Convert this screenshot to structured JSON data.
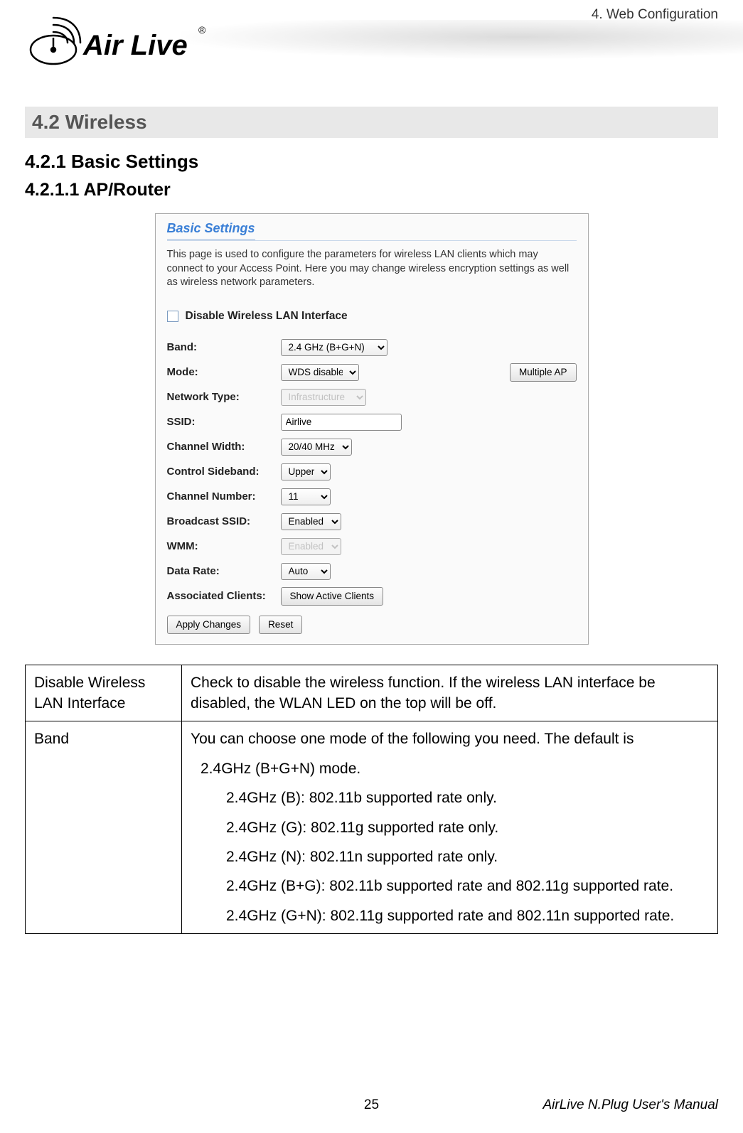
{
  "header": {
    "breadcrumb": "4.  Web  Configuration",
    "logo_brand": "Air Live",
    "logo_reg": "®"
  },
  "section": {
    "title": "4.2   Wireless",
    "sub1": "4.2.1 Basic Settings",
    "sub2": "4.2.1.1 AP/Router"
  },
  "screenshot": {
    "panel_title": "Basic Settings",
    "intro": "This page is used to configure the parameters for wireless LAN clients which may connect to your Access Point. Here you may change wireless encryption settings as well as wireless network parameters.",
    "disable_checkbox_label": "Disable Wireless LAN Interface",
    "rows": {
      "band": {
        "label": "Band:",
        "value": "2.4 GHz (B+G+N)"
      },
      "mode": {
        "label": "Mode:",
        "value": "WDS disable",
        "button": "Multiple AP"
      },
      "network_type": {
        "label": "Network Type:",
        "value": "Infrastructure"
      },
      "ssid": {
        "label": "SSID:",
        "value": "Airlive"
      },
      "channel_width": {
        "label": "Channel Width:",
        "value": "20/40 MHz"
      },
      "control_sideband": {
        "label": "Control Sideband:",
        "value": "Upper"
      },
      "channel_number": {
        "label": "Channel Number:",
        "value": "11"
      },
      "broadcast_ssid": {
        "label": "Broadcast SSID:",
        "value": "Enabled"
      },
      "wmm": {
        "label": "WMM:",
        "value": "Enabled"
      },
      "data_rate": {
        "label": "Data Rate:",
        "value": "Auto"
      },
      "assoc_clients": {
        "label": "Associated Clients:",
        "button": "Show Active Clients"
      }
    },
    "buttons": {
      "apply": "Apply Changes",
      "reset": "Reset"
    }
  },
  "desc_table": {
    "row1": {
      "label": "Disable Wireless LAN Interface",
      "desc": "Check to disable the wireless function. If the wireless LAN interface be disabled, the WLAN LED on the top will be off."
    },
    "row2": {
      "label": "Band",
      "desc_intro": "You can choose one mode of the following you need. The default is",
      "mode_default": "2.4GHz (B+G+N) mode.",
      "item_b": "2.4GHz (B): 802.11b supported rate only.",
      "item_g": "2.4GHz (G): 802.11g supported rate only.",
      "item_n": "2.4GHz (N): 802.11n supported rate only.",
      "item_bg": "2.4GHz (B+G): 802.11b supported rate and 802.11g supported rate.",
      "item_gn": "2.4GHz (G+N): 802.11g supported rate and 802.11n supported rate."
    }
  },
  "footer": {
    "page": "25",
    "manual": "AirLive N.Plug User's Manual"
  }
}
